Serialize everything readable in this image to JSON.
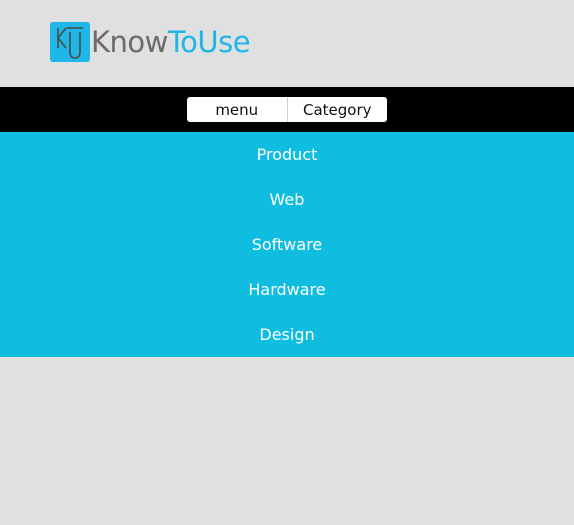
{
  "brand": {
    "logo_mark": "KU",
    "name_part1": "Know",
    "name_part2": "ToUse",
    "colors": {
      "accent": "#1fb6e8",
      "grey_text": "#6b6b6b"
    }
  },
  "menubar": {
    "tabs": [
      {
        "label": "menu"
      },
      {
        "label": "Category"
      }
    ]
  },
  "categories": {
    "items": [
      {
        "label": "Product"
      },
      {
        "label": "Web"
      },
      {
        "label": "Software"
      },
      {
        "label": "Hardware"
      },
      {
        "label": "Design"
      }
    ]
  },
  "colors": {
    "page_bg": "#e0e0e0",
    "menubar_bg": "#000000",
    "panel_bg": "#0ebde0",
    "panel_text": "#ffffff"
  }
}
